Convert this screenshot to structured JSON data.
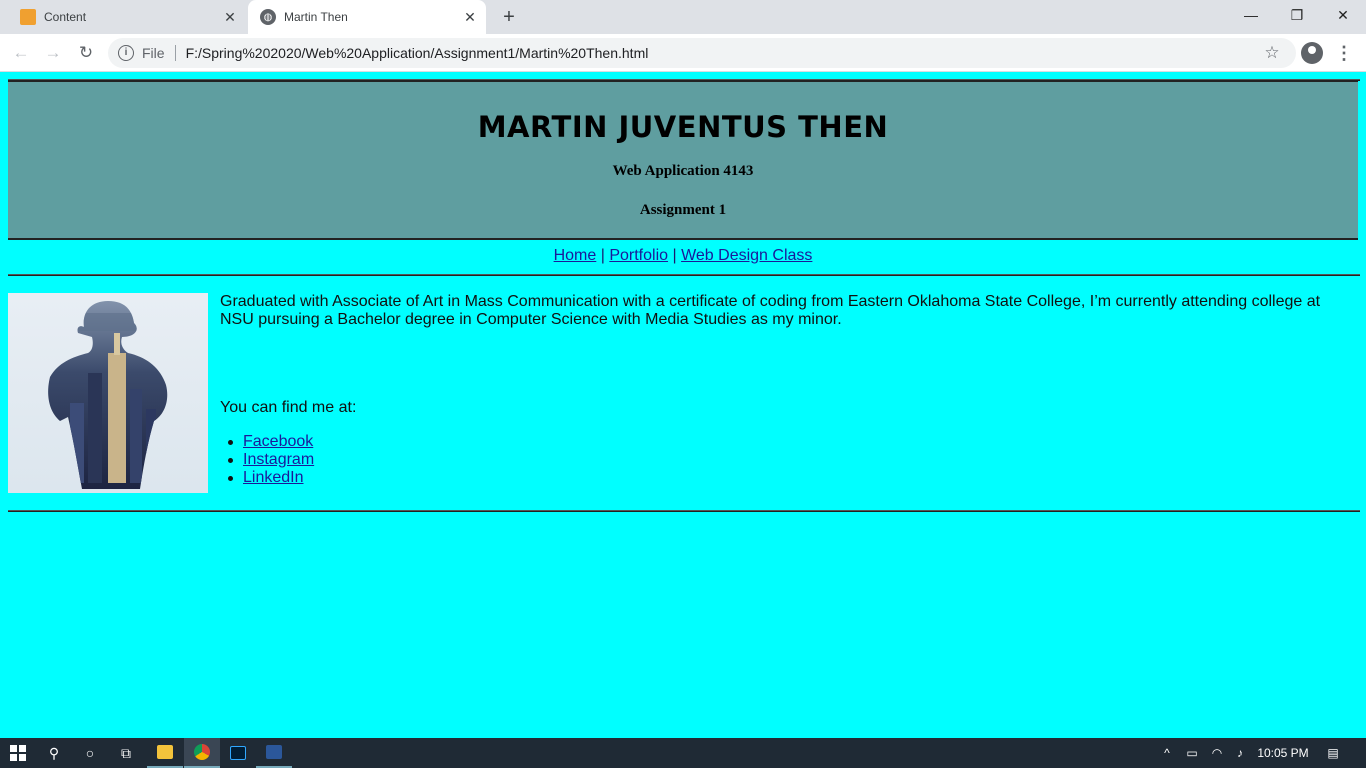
{
  "browser": {
    "tabs": [
      {
        "title": "Content",
        "icon": "edit-icon",
        "active": false
      },
      {
        "title": "Martin Then",
        "icon": "globe-icon",
        "active": true
      }
    ],
    "omnibox": {
      "scheme_label": "File",
      "url": "F:/Spring%202020/Web%20Application/Assignment1/Martin%20Then.html"
    }
  },
  "page": {
    "title": "MARTIN JUVENTUS THEN",
    "subtitle_1": "Web Application 4143",
    "subtitle_2": "Assignment 1",
    "nav": {
      "home": "Home",
      "portfolio": "Portfolio",
      "web_design": "Web Design Class",
      "separator": " | "
    },
    "photo_alt": "double exposure portrait with city skyline",
    "bio": "Graduated with Associate of Art in Mass Communication with a certificate of coding from Eastern Oklahoma State College, I’m currently attending college at NSU pursuing a Bachelor degree in Computer Science with Media Studies as my minor.",
    "find_me": "You can find me at:",
    "links": [
      "Facebook",
      "Instagram",
      "LinkedIn"
    ]
  },
  "colors": {
    "page_background": "#00ffff",
    "header_background": "#5f9ea0",
    "link": "#1a1a9a"
  },
  "taskbar": {
    "clock": "10:05 PM"
  }
}
